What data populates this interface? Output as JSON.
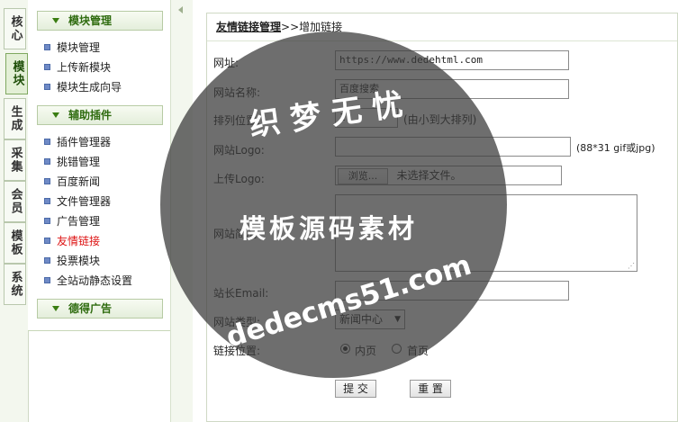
{
  "tabs": [
    {
      "label": "核心",
      "active": false
    },
    {
      "label": "模块",
      "active": true
    },
    {
      "label": "生成",
      "active": false
    },
    {
      "label": "采集",
      "active": false
    },
    {
      "label": "会员",
      "active": false
    },
    {
      "label": "模板",
      "active": false
    },
    {
      "label": "系统",
      "active": false
    }
  ],
  "menu": {
    "groups": [
      {
        "title": "模块管理",
        "items": [
          "模块管理",
          "上传新模块",
          "模块生成向导"
        ]
      },
      {
        "title": "辅助插件",
        "items": [
          "插件管理器",
          "挑错管理",
          "百度新闻",
          "文件管理器",
          "广告管理",
          "友情链接",
          "投票模块",
          "全站动静态设置"
        ]
      },
      {
        "title": "德得广告",
        "items": []
      }
    ],
    "active_item": "友情链接"
  },
  "crumb": {
    "current": "友情链接管理",
    "sep": ">>",
    "page": "增加链接"
  },
  "form": {
    "url_label": "网址:",
    "url_value": "https://www.dedehtml.com",
    "name_label": "网站名称:",
    "name_value": "百度搜索",
    "order_label": "排列位置:",
    "order_value": "1",
    "order_hint": "(由小到大排列)",
    "logo_label": "网站Logo:",
    "logo_value": "",
    "logo_hint": "(88*31 gif或jpg)",
    "upload_label": "上传Logo:",
    "browse_label": "浏览...",
    "no_file": "未选择文件。",
    "desc_label": "网站简况:",
    "email_label": "站长Email:",
    "type_label": "网站类型:",
    "type_value": "新闻中心",
    "position_label": "链接位置:",
    "position_options": [
      "内页",
      "首页"
    ],
    "position_selected": "内页",
    "submit_label": "提 交",
    "reset_label": "重 置"
  },
  "watermark": {
    "line1": "织 梦 无 忧",
    "line2": "模板源码素材",
    "line3": "dedecms51.com"
  }
}
